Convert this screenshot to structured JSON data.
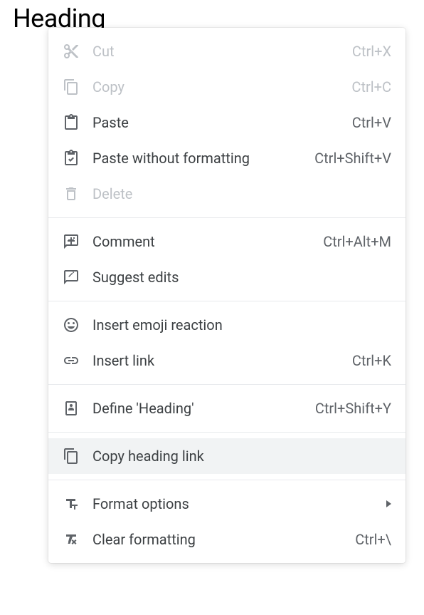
{
  "document": {
    "heading_text": "Heading"
  },
  "menu": {
    "groups": [
      {
        "items": [
          {
            "id": "cut",
            "label": "Cut",
            "shortcut": "Ctrl+X",
            "disabled": true,
            "icon": "cut-icon"
          },
          {
            "id": "copy",
            "label": "Copy",
            "shortcut": "Ctrl+C",
            "disabled": true,
            "icon": "copy-icon"
          },
          {
            "id": "paste",
            "label": "Paste",
            "shortcut": "Ctrl+V",
            "disabled": false,
            "icon": "paste-icon"
          },
          {
            "id": "paste-no-format",
            "label": "Paste without formatting",
            "shortcut": "Ctrl+Shift+V",
            "disabled": false,
            "icon": "paste-no-format-icon"
          },
          {
            "id": "delete",
            "label": "Delete",
            "shortcut": "",
            "disabled": true,
            "icon": "delete-icon"
          }
        ]
      },
      {
        "items": [
          {
            "id": "comment",
            "label": "Comment",
            "shortcut": "Ctrl+Alt+M",
            "disabled": false,
            "icon": "comment-icon"
          },
          {
            "id": "suggest-edits",
            "label": "Suggest edits",
            "shortcut": "",
            "disabled": false,
            "icon": "suggest-edits-icon"
          }
        ]
      },
      {
        "items": [
          {
            "id": "insert-emoji",
            "label": "Insert emoji reaction",
            "shortcut": "",
            "disabled": false,
            "icon": "emoji-icon"
          },
          {
            "id": "insert-link",
            "label": "Insert link",
            "shortcut": "Ctrl+K",
            "disabled": false,
            "icon": "link-icon"
          }
        ]
      },
      {
        "items": [
          {
            "id": "define",
            "label": "Define 'Heading'",
            "shortcut": "Ctrl+Shift+Y",
            "disabled": false,
            "icon": "define-icon"
          }
        ]
      },
      {
        "items": [
          {
            "id": "copy-heading-link",
            "label": "Copy heading link",
            "shortcut": "",
            "disabled": false,
            "highlighted": true,
            "icon": "copy-link-icon"
          }
        ]
      },
      {
        "items": [
          {
            "id": "format-options",
            "label": "Format options",
            "shortcut": "",
            "disabled": false,
            "submenu": true,
            "icon": "format-icon"
          },
          {
            "id": "clear-formatting",
            "label": "Clear formatting",
            "shortcut": "Ctrl+\\",
            "disabled": false,
            "icon": "clear-format-icon"
          }
        ]
      }
    ]
  }
}
